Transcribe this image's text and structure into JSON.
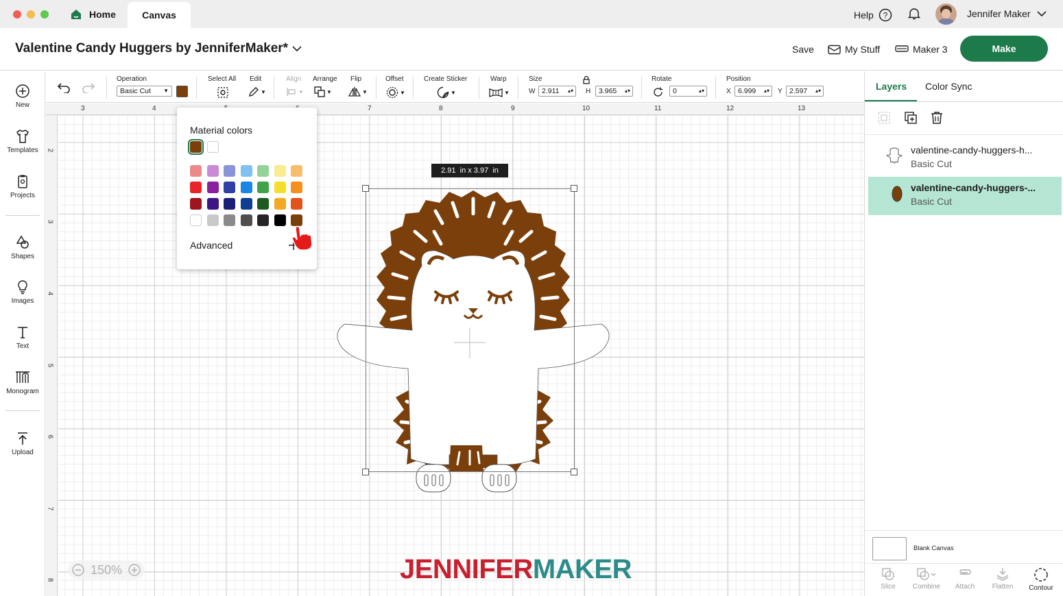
{
  "window": {
    "tabs": [
      {
        "label": "Home"
      },
      {
        "label": "Canvas"
      }
    ],
    "help_label": "Help",
    "user_name": "Jennifer Maker"
  },
  "header": {
    "project_title": "Valentine Candy Huggers by JenniferMaker*",
    "save_label": "Save",
    "my_stuff_label": "My Stuff",
    "machine_label": "Maker 3",
    "make_label": "Make"
  },
  "sidebar": {
    "items": [
      {
        "label": "New",
        "icon": "plus-circle-icon"
      },
      {
        "label": "Templates",
        "icon": "shirt-icon"
      },
      {
        "label": "Projects",
        "icon": "clipboard-icon"
      },
      {
        "label": "Shapes",
        "icon": "shapes-icon"
      },
      {
        "label": "Images",
        "icon": "bulb-icon"
      },
      {
        "label": "Text",
        "icon": "text-icon"
      },
      {
        "label": "Monogram",
        "icon": "monogram-icon"
      },
      {
        "label": "Upload",
        "icon": "upload-icon"
      }
    ]
  },
  "toolbar": {
    "operation_label": "Operation",
    "operation_value": "Basic Cut",
    "operation_color": "#7a3f0a",
    "select_all_label": "Select All",
    "edit_label": "Edit",
    "align_label": "Align",
    "arrange_label": "Arrange",
    "flip_label": "Flip",
    "offset_label": "Offset",
    "create_sticker_label": "Create Sticker",
    "warp_label": "Warp",
    "size_label": "Size",
    "size_w_label": "W",
    "size_w": "2.911",
    "size_h_label": "H",
    "size_h": "3.965",
    "rotate_label": "Rotate",
    "rotate_value": "0",
    "position_label": "Position",
    "pos_x_label": "X",
    "pos_x": "6.999",
    "pos_y_label": "Y",
    "pos_y": "2.597"
  },
  "ruler": {
    "top": [
      "3",
      "4",
      "5",
      "6",
      "7",
      "8",
      "9",
      "10",
      "11",
      "12",
      "13"
    ],
    "left": [
      "2",
      "3",
      "4",
      "5",
      "6",
      "7",
      "8"
    ]
  },
  "canvas": {
    "size_tooltip": "2.91  in x 3.97  in",
    "zoom_label": "150%",
    "watermark_part1": "JENNIFER",
    "watermark_part2": "MAKER",
    "watermark_color1": "#c8202f",
    "watermark_color2": "#2d8b8b"
  },
  "color_popup": {
    "title": "Material colors",
    "current_colors": [
      "#7a3f0a",
      "#ffffff"
    ],
    "palette": [
      [
        "#ec8a8a",
        "#c98bd6",
        "#8b93da",
        "#7ec1f2",
        "#93d39a",
        "#f8ec8f",
        "#f6bd6c"
      ],
      [
        "#e8242b",
        "#8a1fa0",
        "#2f3fa3",
        "#1a87e4",
        "#3fa34a",
        "#f6df2b",
        "#f5901e"
      ],
      [
        "#a0151d",
        "#3e1585",
        "#1b1f78",
        "#0e3d94",
        "#1d5a1f",
        "#f3a923",
        "#e2531a"
      ],
      [
        "#ffffff",
        "#c9c9c9",
        "#8a8a8a",
        "#4f4f4f",
        "#252525",
        "#000000",
        "#7a3f0a"
      ]
    ],
    "advanced_label": "Advanced"
  },
  "right_panel": {
    "tabs": [
      {
        "label": "Layers"
      },
      {
        "label": "Color Sync"
      }
    ],
    "layers": [
      {
        "name": "valentine-candy-huggers-h...",
        "operation": "Basic Cut",
        "selected": false
      },
      {
        "name": "valentine-candy-huggers-...",
        "operation": "Basic Cut",
        "selected": true
      }
    ],
    "blank_canvas_label": "Blank Canvas",
    "bottom_tools": [
      {
        "label": "Slice"
      },
      {
        "label": "Combine"
      },
      {
        "label": "Attach"
      },
      {
        "label": "Flatten"
      },
      {
        "label": "Contour"
      }
    ]
  }
}
